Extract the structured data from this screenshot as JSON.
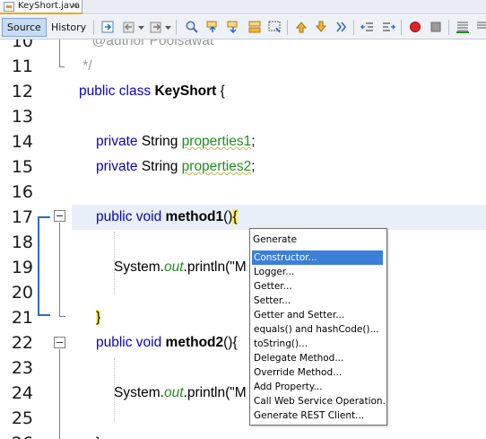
{
  "tab": {
    "filename": "KeyShort.java",
    "close": "✕"
  },
  "toolbar": {
    "source_label": "Source",
    "history_label": "History",
    "icons": [
      "last-edit-icon",
      "back-icon",
      "forward-icon",
      "find-selection-icon",
      "find-previous-icon",
      "find-next-icon",
      "toggle-highlight-icon",
      "toggle-rectangular-selection-icon",
      "previous-bookmark-icon",
      "next-bookmark-icon",
      "toggle-bookmark-icon",
      "shift-left-icon",
      "shift-right-icon",
      "start-macro-icon",
      "stop-macro-icon",
      "comment-icon"
    ]
  },
  "editor": {
    "lines": [
      {
        "num": "10",
        "text": " * @author Poolsawat"
      },
      {
        "num": "11",
        "text": " */"
      },
      {
        "num": "12",
        "kw": "public class ",
        "name": "KeyShort",
        "rest": " {"
      },
      {
        "num": "13",
        "text": ""
      },
      {
        "num": "14",
        "kw": "private ",
        "type": "String ",
        "field": "properties1",
        "rest": ";"
      },
      {
        "num": "15",
        "kw": "private ",
        "type": "String ",
        "field": "properties2",
        "rest": ";"
      },
      {
        "num": "16",
        "text": ""
      },
      {
        "num": "17",
        "kw": "public void ",
        "name": "method1",
        "rest": "()",
        "brace": "{"
      },
      {
        "num": "18",
        "text": ""
      },
      {
        "num": "19",
        "pre": "System.",
        "italic": "out",
        "post": ".println(\"M"
      },
      {
        "num": "20",
        "text": ""
      },
      {
        "num": "21",
        "brace": "}"
      },
      {
        "num": "22",
        "kw": "public void ",
        "name": "method2",
        "rest": "(){"
      },
      {
        "num": "23",
        "text": ""
      },
      {
        "num": "24",
        "pre": "System.",
        "italic": "out",
        "post": ".println(\"M"
      },
      {
        "num": "25",
        "text": ""
      },
      {
        "num": "26",
        "text": "}"
      }
    ]
  },
  "popup": {
    "title": "Generate",
    "items": [
      "Constructor...",
      "Logger...",
      "Getter...",
      "Setter...",
      "Getter and Setter...",
      "equals() and hashCode()...",
      "toString()...",
      "Delegate Method...",
      "Override Method...",
      "Add Property...",
      "Call Web Service Operation...",
      "Generate REST Client..."
    ],
    "selected_index": 0
  },
  "colors": {
    "keyword": "#0a00cc",
    "field": "#1d8f1d",
    "selection": "#3b7fd8",
    "brace_highlight": "#fbf15a"
  }
}
